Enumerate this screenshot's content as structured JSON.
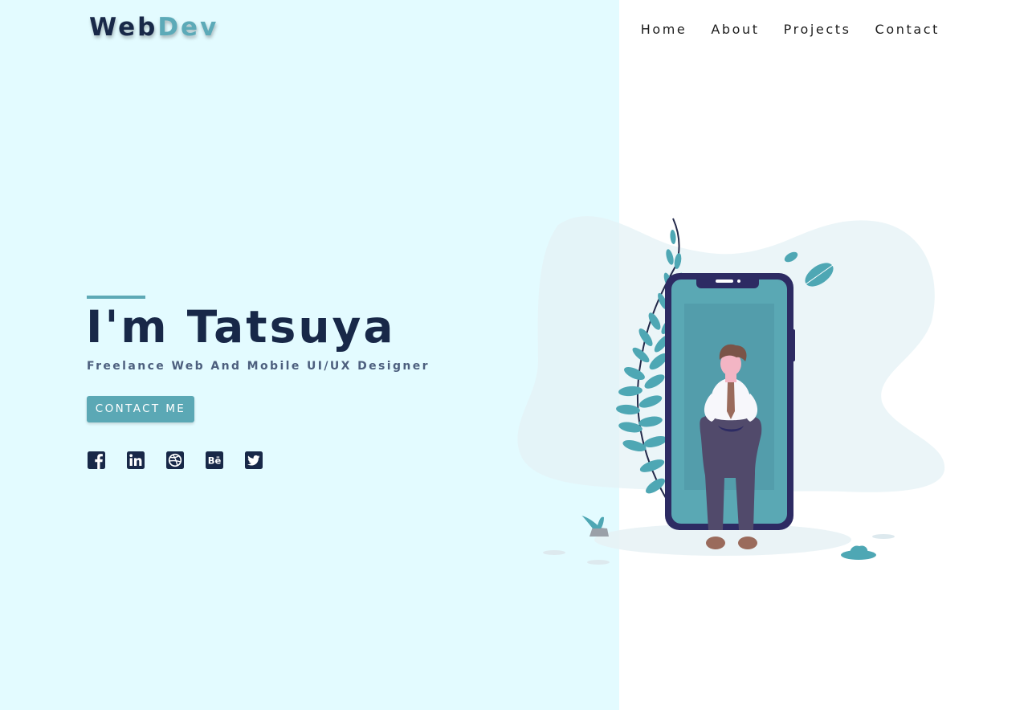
{
  "brand": {
    "part1": "Web",
    "part2": "Dev"
  },
  "nav": {
    "items": [
      {
        "label": "Home"
      },
      {
        "label": "About"
      },
      {
        "label": "Projects"
      },
      {
        "label": "Contact"
      }
    ]
  },
  "hero": {
    "title": "I'm Tatsuya",
    "subtitle": "Freelance Web And Mobile UI/UX Designer",
    "cta_label": "CONTACT ME"
  },
  "social": {
    "icons": [
      "facebook-icon",
      "linkedin-icon",
      "dribbble-icon",
      "behance-icon",
      "twitter-icon"
    ],
    "behance_text": "Bē"
  },
  "colors": {
    "left_background": "#e3fbff",
    "navy": "#182848",
    "accent": "#5ba8b5",
    "phone_frame": "#2d2b63"
  }
}
